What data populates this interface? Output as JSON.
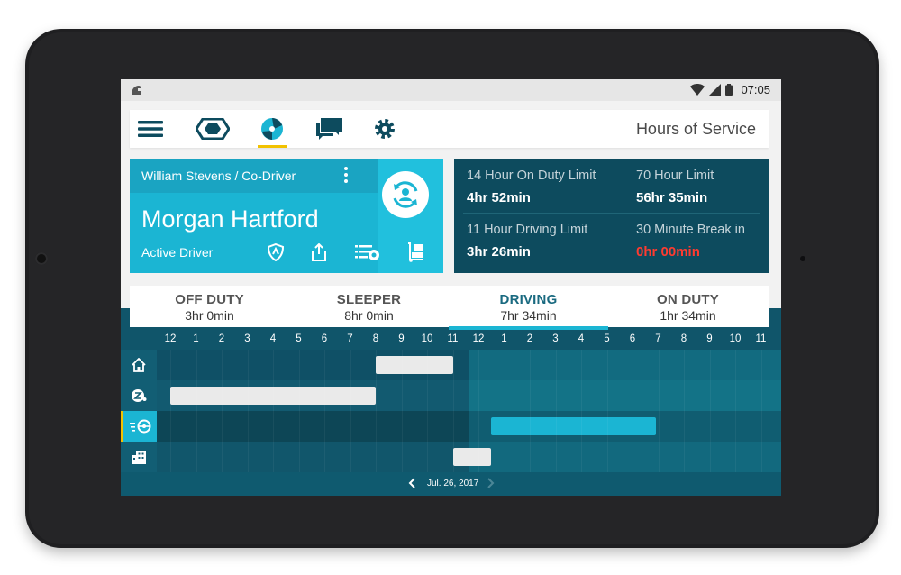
{
  "statusbar": {
    "time": "07:05",
    "left_icon": "app-helmet-icon",
    "icons": [
      "wifi-icon",
      "signal-icon",
      "battery-icon"
    ]
  },
  "topbar": {
    "title": "Hours of Service",
    "icons": [
      "menu-icon",
      "hexagon-icon",
      "hos-clock-icon",
      "messages-icon",
      "settings-icon"
    ],
    "active_icon": "hos-clock-icon"
  },
  "driver": {
    "codriver": "William Stevens / Co-Driver",
    "name": "Morgan Hartford",
    "status": "Active Driver",
    "actions": [
      "shield-icon",
      "share-icon",
      "log-list-icon",
      "dolly-icon"
    ]
  },
  "limits": [
    {
      "label": "14 Hour On Duty Limit",
      "value": "4hr 52min"
    },
    {
      "label": "70 Hour Limit",
      "value": "56hr 35min"
    },
    {
      "label": "11 Hour Driving Limit",
      "value": "3hr 26min"
    },
    {
      "label": "30 Minute Break in",
      "value": "0hr 00min",
      "warning": true
    }
  ],
  "tabs": [
    {
      "name": "OFF DUTY",
      "duration": "3hr 0min"
    },
    {
      "name": "SLEEPER",
      "duration": "8hr 0min"
    },
    {
      "name": "DRIVING",
      "duration": "7hr 34min",
      "active": true
    },
    {
      "name": "ON DUTY",
      "duration": "1hr 34min"
    }
  ],
  "chart": {
    "hours": [
      "12",
      "1",
      "2",
      "3",
      "4",
      "5",
      "6",
      "7",
      "8",
      "9",
      "10",
      "11",
      "12",
      "1",
      "2",
      "3",
      "4",
      "5",
      "6",
      "7",
      "8",
      "9",
      "10",
      "11"
    ],
    "rows": [
      {
        "status": "off-duty",
        "icon": "home-icon",
        "segments": [
          [
            8.0,
            11.0
          ]
        ]
      },
      {
        "status": "sleeper",
        "icon": "sleep-icon",
        "segments": [
          [
            0.0,
            8.0
          ]
        ]
      },
      {
        "status": "driving",
        "icon": "steering-wheel-icon",
        "segments": [
          [
            12.5,
            18.9
          ]
        ],
        "active": true
      },
      {
        "status": "on-duty",
        "icon": "building-icon",
        "segments": [
          [
            11.0,
            12.5
          ]
        ]
      }
    ],
    "date": "Jul. 26, 2017"
  }
}
